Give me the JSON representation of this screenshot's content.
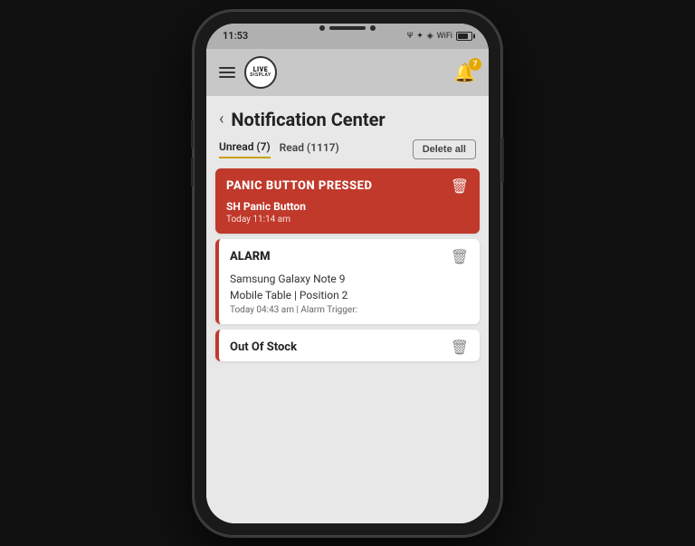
{
  "phone": {
    "status_bar": {
      "time": "11:53",
      "battery_label": "Battery"
    },
    "header": {
      "logo_line1": "LIVE",
      "logo_line2": "DISPLAY",
      "bell_badge": "7",
      "hamburger_label": "Menu"
    },
    "page": {
      "back_label": "‹",
      "title": "Notification Center",
      "tabs": [
        {
          "label": "Unread (7)",
          "active": true
        },
        {
          "label": "Read (1117)",
          "active": false
        }
      ],
      "delete_all_label": "Delete all"
    },
    "notifications": [
      {
        "type": "PANIC BUTTON PRESSED",
        "style": "panic",
        "device": "SH Panic Button",
        "detail": "",
        "time": "Today 11:14 am"
      },
      {
        "type": "ALARM",
        "style": "alarm",
        "device": "Samsung Galaxy Note 9",
        "detail": "Mobile Table | Position 2",
        "time": "Today 04:43 am | Alarm Trigger:"
      },
      {
        "type": "Out Of Stock",
        "style": "out",
        "device": "",
        "detail": "",
        "time": ""
      }
    ],
    "icons": {
      "back": "‹",
      "bell": "🔔",
      "trash": "🗑"
    }
  }
}
